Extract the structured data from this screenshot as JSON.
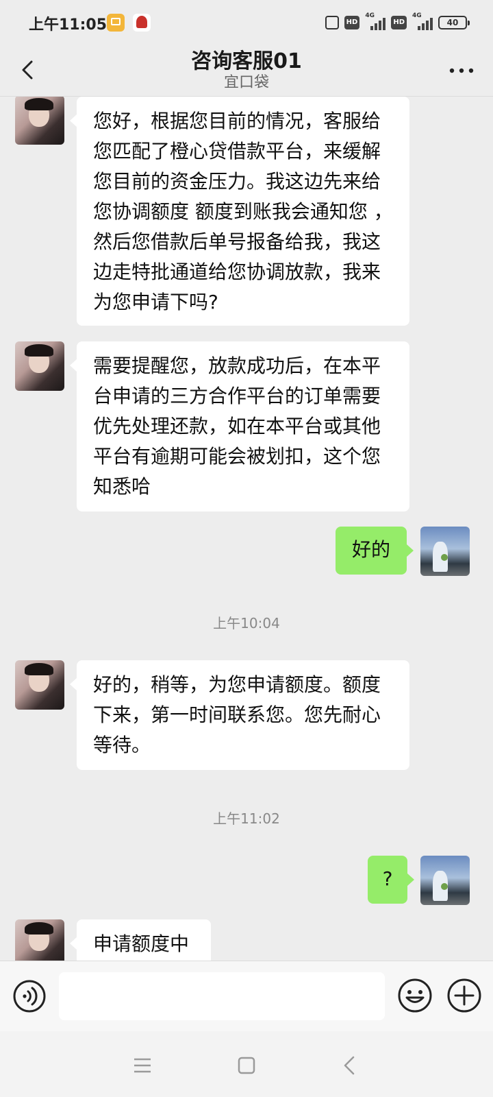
{
  "status_bar": {
    "time": "上午11:05",
    "hd1": "HD",
    "hd2": "HD",
    "network1": "4G",
    "network2": "4G",
    "battery": "40"
  },
  "header": {
    "title": "咨询客服01",
    "subtitle": "宜口袋",
    "back_icon": "chevron-left-icon",
    "more_icon": "more-dots-icon"
  },
  "messages": [
    {
      "side": "left",
      "text": "您好，根据您目前的情况，客服给您匹配了橙心贷借款平台，来缓解您目前的资金压力。我这边先来给您协调额度 额度到账我会通知您 ，然后您借款后单号报备给我，我这边走特批通道给您协调放款，我来为您申请下吗?"
    },
    {
      "side": "left",
      "text": "需要提醒您，放款成功后，在本平台申请的三方合作平台的订单需要优先处理还款，如在本平台或其他平台有逾期可能会被划扣，这个您知悉哈"
    },
    {
      "side": "right",
      "text": "好的"
    },
    {
      "timestamp": "上午10:04"
    },
    {
      "side": "left",
      "text": "好的，稍等，为您申请额度。额度下来，第一时间联系您。您先耐心等待。"
    },
    {
      "timestamp": "上午11:02"
    },
    {
      "side": "right",
      "text": "?"
    },
    {
      "side": "left",
      "text": "申请额度中"
    }
  ],
  "input_bar": {
    "voice_icon": "voice-icon",
    "input_value": "",
    "emoji_icon": "emoji-icon",
    "plus_icon": "plus-icon"
  },
  "nav_bar": {
    "menu_icon": "menu-icon",
    "home_icon": "home-icon",
    "back_icon": "back-icon"
  },
  "colors": {
    "background": "#ededed",
    "bubble_self": "#95ec69",
    "bubble_other": "#ffffff"
  }
}
